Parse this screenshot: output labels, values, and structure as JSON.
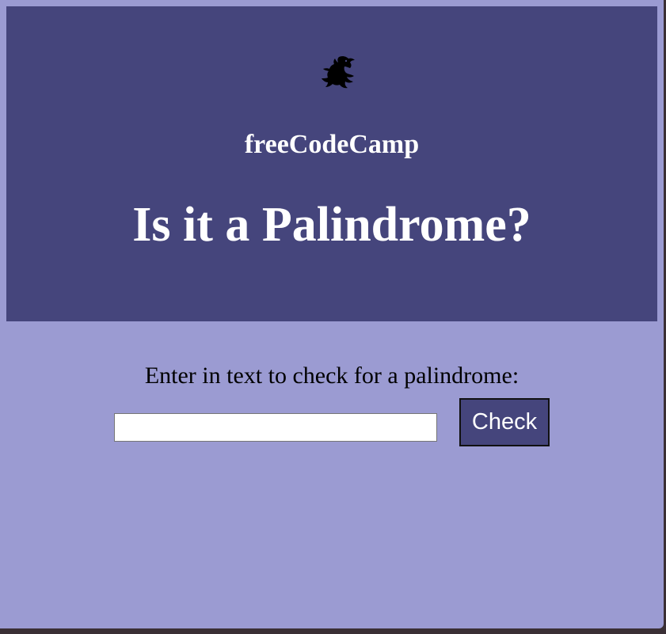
{
  "header": {
    "logo_icon": "freecodecamp-dragon-icon",
    "brand": "freeCodeCamp",
    "title": "Is it a Palindrome?"
  },
  "form": {
    "prompt": "Enter in text to check for a palindrome:",
    "input_value": "",
    "input_placeholder": "",
    "check_button": "Check"
  },
  "colors": {
    "header_bg": "#45457c",
    "page_bg": "#9b9bd2",
    "button_bg": "#45457c",
    "text_light": "#ffffff"
  }
}
